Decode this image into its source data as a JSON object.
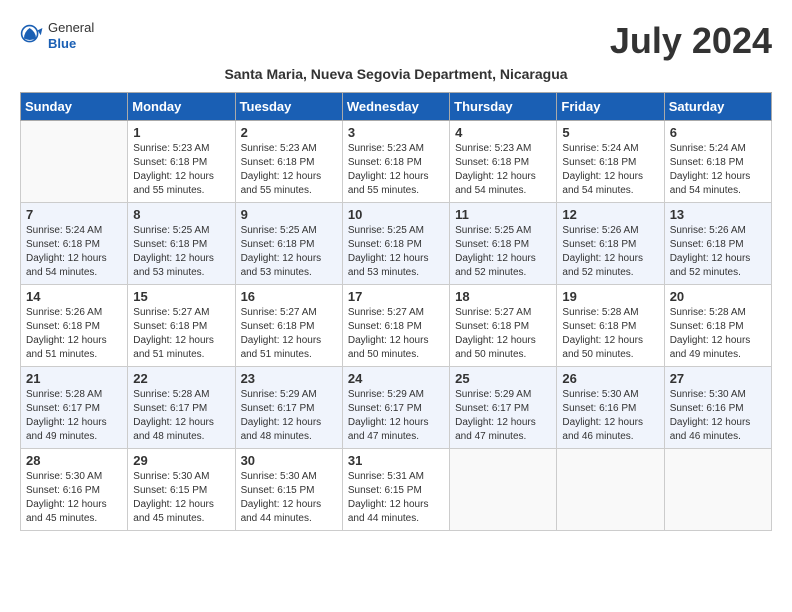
{
  "header": {
    "logo_general": "General",
    "logo_blue": "Blue",
    "month_title": "July 2024",
    "subtitle": "Santa Maria, Nueva Segovia Department, Nicaragua"
  },
  "days_of_week": [
    "Sunday",
    "Monday",
    "Tuesday",
    "Wednesday",
    "Thursday",
    "Friday",
    "Saturday"
  ],
  "weeks": [
    [
      {
        "day": "",
        "info": ""
      },
      {
        "day": "1",
        "info": "Sunrise: 5:23 AM\nSunset: 6:18 PM\nDaylight: 12 hours\nand 55 minutes."
      },
      {
        "day": "2",
        "info": "Sunrise: 5:23 AM\nSunset: 6:18 PM\nDaylight: 12 hours\nand 55 minutes."
      },
      {
        "day": "3",
        "info": "Sunrise: 5:23 AM\nSunset: 6:18 PM\nDaylight: 12 hours\nand 55 minutes."
      },
      {
        "day": "4",
        "info": "Sunrise: 5:23 AM\nSunset: 6:18 PM\nDaylight: 12 hours\nand 54 minutes."
      },
      {
        "day": "5",
        "info": "Sunrise: 5:24 AM\nSunset: 6:18 PM\nDaylight: 12 hours\nand 54 minutes."
      },
      {
        "day": "6",
        "info": "Sunrise: 5:24 AM\nSunset: 6:18 PM\nDaylight: 12 hours\nand 54 minutes."
      }
    ],
    [
      {
        "day": "7",
        "info": "Sunrise: 5:24 AM\nSunset: 6:18 PM\nDaylight: 12 hours\nand 54 minutes."
      },
      {
        "day": "8",
        "info": "Sunrise: 5:25 AM\nSunset: 6:18 PM\nDaylight: 12 hours\nand 53 minutes."
      },
      {
        "day": "9",
        "info": "Sunrise: 5:25 AM\nSunset: 6:18 PM\nDaylight: 12 hours\nand 53 minutes."
      },
      {
        "day": "10",
        "info": "Sunrise: 5:25 AM\nSunset: 6:18 PM\nDaylight: 12 hours\nand 53 minutes."
      },
      {
        "day": "11",
        "info": "Sunrise: 5:25 AM\nSunset: 6:18 PM\nDaylight: 12 hours\nand 52 minutes."
      },
      {
        "day": "12",
        "info": "Sunrise: 5:26 AM\nSunset: 6:18 PM\nDaylight: 12 hours\nand 52 minutes."
      },
      {
        "day": "13",
        "info": "Sunrise: 5:26 AM\nSunset: 6:18 PM\nDaylight: 12 hours\nand 52 minutes."
      }
    ],
    [
      {
        "day": "14",
        "info": "Sunrise: 5:26 AM\nSunset: 6:18 PM\nDaylight: 12 hours\nand 51 minutes."
      },
      {
        "day": "15",
        "info": "Sunrise: 5:27 AM\nSunset: 6:18 PM\nDaylight: 12 hours\nand 51 minutes."
      },
      {
        "day": "16",
        "info": "Sunrise: 5:27 AM\nSunset: 6:18 PM\nDaylight: 12 hours\nand 51 minutes."
      },
      {
        "day": "17",
        "info": "Sunrise: 5:27 AM\nSunset: 6:18 PM\nDaylight: 12 hours\nand 50 minutes."
      },
      {
        "day": "18",
        "info": "Sunrise: 5:27 AM\nSunset: 6:18 PM\nDaylight: 12 hours\nand 50 minutes."
      },
      {
        "day": "19",
        "info": "Sunrise: 5:28 AM\nSunset: 6:18 PM\nDaylight: 12 hours\nand 50 minutes."
      },
      {
        "day": "20",
        "info": "Sunrise: 5:28 AM\nSunset: 6:18 PM\nDaylight: 12 hours\nand 49 minutes."
      }
    ],
    [
      {
        "day": "21",
        "info": "Sunrise: 5:28 AM\nSunset: 6:17 PM\nDaylight: 12 hours\nand 49 minutes."
      },
      {
        "day": "22",
        "info": "Sunrise: 5:28 AM\nSunset: 6:17 PM\nDaylight: 12 hours\nand 48 minutes."
      },
      {
        "day": "23",
        "info": "Sunrise: 5:29 AM\nSunset: 6:17 PM\nDaylight: 12 hours\nand 48 minutes."
      },
      {
        "day": "24",
        "info": "Sunrise: 5:29 AM\nSunset: 6:17 PM\nDaylight: 12 hours\nand 47 minutes."
      },
      {
        "day": "25",
        "info": "Sunrise: 5:29 AM\nSunset: 6:17 PM\nDaylight: 12 hours\nand 47 minutes."
      },
      {
        "day": "26",
        "info": "Sunrise: 5:30 AM\nSunset: 6:16 PM\nDaylight: 12 hours\nand 46 minutes."
      },
      {
        "day": "27",
        "info": "Sunrise: 5:30 AM\nSunset: 6:16 PM\nDaylight: 12 hours\nand 46 minutes."
      }
    ],
    [
      {
        "day": "28",
        "info": "Sunrise: 5:30 AM\nSunset: 6:16 PM\nDaylight: 12 hours\nand 45 minutes."
      },
      {
        "day": "29",
        "info": "Sunrise: 5:30 AM\nSunset: 6:15 PM\nDaylight: 12 hours\nand 45 minutes."
      },
      {
        "day": "30",
        "info": "Sunrise: 5:30 AM\nSunset: 6:15 PM\nDaylight: 12 hours\nand 44 minutes."
      },
      {
        "day": "31",
        "info": "Sunrise: 5:31 AM\nSunset: 6:15 PM\nDaylight: 12 hours\nand 44 minutes."
      },
      {
        "day": "",
        "info": ""
      },
      {
        "day": "",
        "info": ""
      },
      {
        "day": "",
        "info": ""
      }
    ]
  ]
}
